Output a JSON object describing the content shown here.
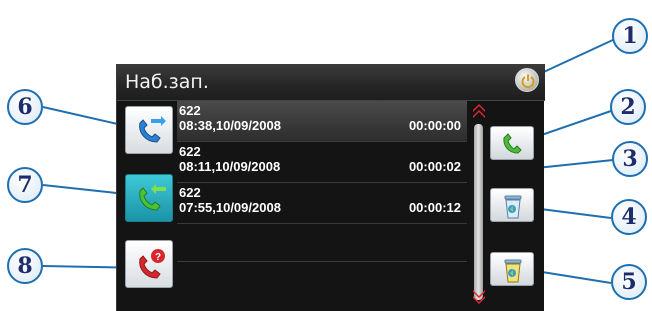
{
  "screen": {
    "title": "Наб.зап.",
    "icons": {
      "power": "power-icon",
      "dial": "phone-dial-icon",
      "incoming": "phone-incoming-icon",
      "missed": "phone-missed-icon",
      "call": "phone-call-icon",
      "delete_one": "trash-icon",
      "delete_all": "trash-all-icon",
      "scroll_up": "chevron-double-up-icon",
      "scroll_down": "chevron-double-down-icon"
    }
  },
  "call_log": [
    {
      "number": "622",
      "datetime": "08:38,10/09/2008",
      "duration": "00:00:00",
      "selected": true
    },
    {
      "number": "622",
      "datetime": "08:11,10/09/2008",
      "duration": "00:00:02",
      "selected": false
    },
    {
      "number": "622",
      "datetime": "07:55,10/09/2008",
      "duration": "00:00:12",
      "selected": false
    }
  ],
  "callouts": [
    "1",
    "2",
    "3",
    "4",
    "5",
    "6",
    "7",
    "8"
  ],
  "colors": {
    "screen_bg": "#141414",
    "callout_border": "#1e6fb0",
    "callout_text": "#1d2d6b",
    "scroll_arrow": "#e0262f",
    "active_tab": "#2aaec0"
  }
}
